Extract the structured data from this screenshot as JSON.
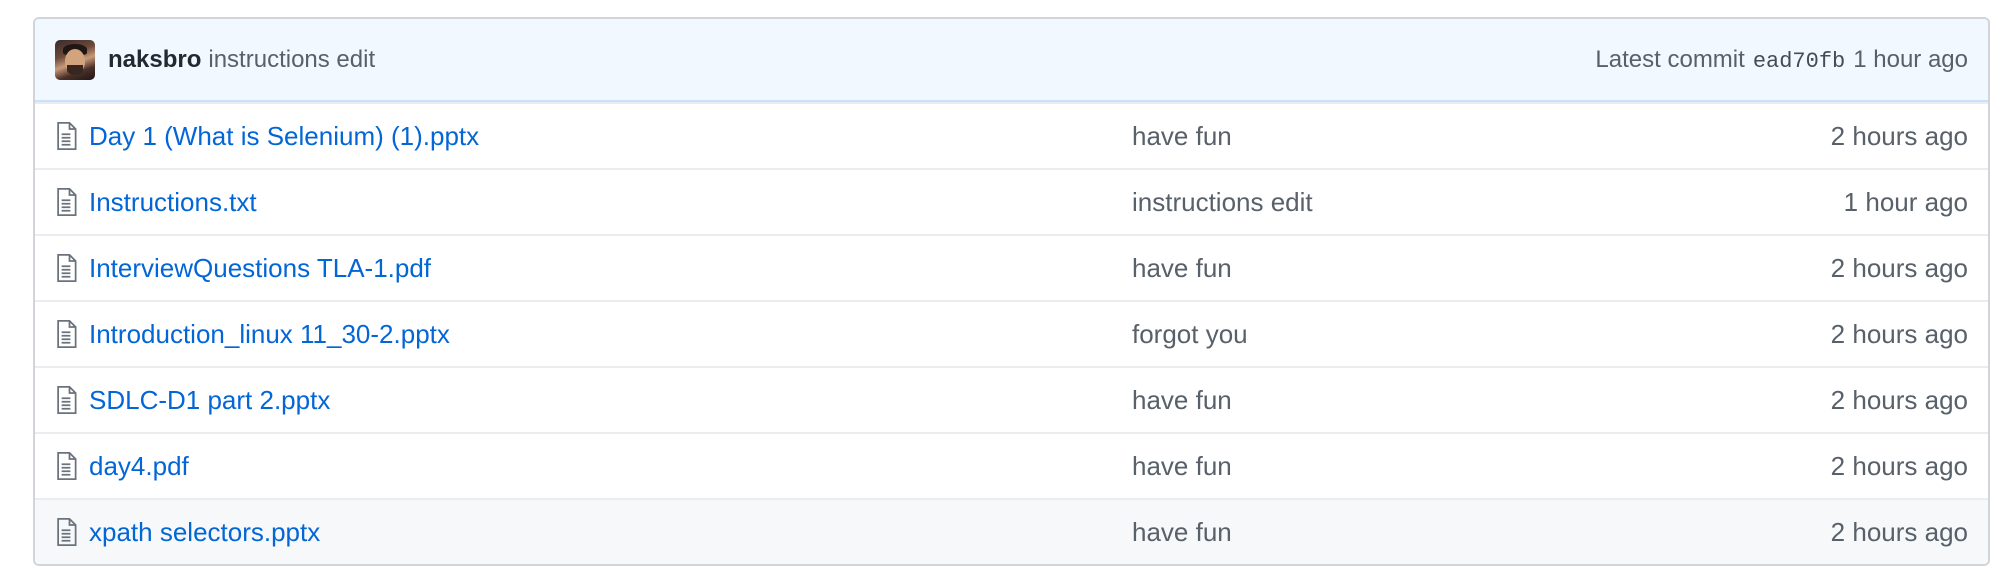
{
  "latest_commit": {
    "author": "naksbro",
    "message": "instructions edit",
    "label": "Latest commit",
    "sha": "ead70fb",
    "age": "1 hour ago"
  },
  "files": [
    {
      "name": "Day 1 (What is Selenium) (1).pptx",
      "message": "have fun",
      "age": "2 hours ago",
      "icon": "file-icon"
    },
    {
      "name": "Instructions.txt",
      "message": "instructions edit",
      "age": "1 hour ago",
      "icon": "file-icon"
    },
    {
      "name": "InterviewQuestions TLA-1.pdf",
      "message": "have fun",
      "age": "2 hours ago",
      "icon": "file-icon"
    },
    {
      "name": "Introduction_linux 11_30-2.pptx",
      "message": "forgot you",
      "age": "2 hours ago",
      "icon": "file-icon"
    },
    {
      "name": "SDLC-D1 part 2.pptx",
      "message": "have fun",
      "age": "2 hours ago",
      "icon": "file-icon"
    },
    {
      "name": "day4.pdf",
      "message": "have fun",
      "age": "2 hours ago",
      "icon": "file-icon"
    },
    {
      "name": "xpath selectors.pptx",
      "message": "have fun",
      "age": "2 hours ago",
      "icon": "file-icon"
    }
  ],
  "colors": {
    "link": "#0366d6",
    "muted": "#586069",
    "header_bg": "#f1f8ff",
    "border": "#d1d5da"
  }
}
